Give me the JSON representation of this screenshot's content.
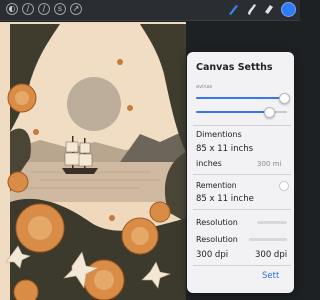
{
  "toolbar": {
    "left_icons": [
      "gallery-icon",
      "wrench-icon",
      "magic-wand-icon",
      "selection-icon",
      "transform-icon"
    ],
    "right_tools": [
      "brush-icon",
      "smudge-icon",
      "eraser-icon",
      "layers-icon"
    ],
    "color_accent": "#2f7bf6"
  },
  "artwork": {
    "description_colors": {
      "background": "#efd8bb",
      "sun": "#b9aa97",
      "sea": "#cdb8a0",
      "flowers": "#d98c45",
      "leaves": "#3b3a2c"
    }
  },
  "panel": {
    "title": "Canvas Setths",
    "subtitle": "avinas",
    "slider1_value": 0.97,
    "slider2_value": 0.8,
    "dimensions_label": "Dimentions",
    "dimensions_value": "85 x 11 inchs",
    "units_label": "inches",
    "units_value": "300 mi",
    "orientation_label": "Remention",
    "orientation_value": "85 x 11 inche",
    "resolution_header": "Resolution",
    "resolution_label": "Resolution",
    "resolution_left": "300 dpi",
    "resolution_right": "300 dpi",
    "action": "Sett"
  }
}
